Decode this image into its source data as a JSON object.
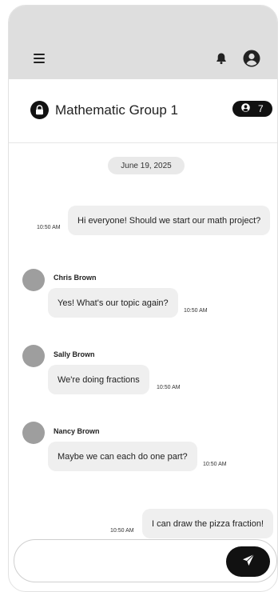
{
  "header": {
    "menu_icon": "hamburger-menu-icon",
    "notification_icon": "bell-icon",
    "profile_icon": "user-avatar-icon"
  },
  "group": {
    "icon": "lock-icon",
    "title": "Mathematic Group 1",
    "member_icon": "person-icon",
    "member_count": "7"
  },
  "chat": {
    "date_label": "June 19, 2025",
    "messages": [
      {
        "direction": "outgoing",
        "sender": "",
        "text": "Hi everyone! Should we start our math project?",
        "time": "10:50 AM"
      },
      {
        "direction": "incoming",
        "sender": "Chris Brown",
        "text": "Yes! What's our topic again?",
        "time": "10:50 AM"
      },
      {
        "direction": "incoming",
        "sender": "Sally Brown",
        "text": "We're doing fractions",
        "time": "10:50 AM"
      },
      {
        "direction": "incoming",
        "sender": "Nancy Brown",
        "text": "Maybe we can each do one part?",
        "time": "10:50 AM"
      },
      {
        "direction": "outgoing",
        "sender": "",
        "text": "I can draw the pizza fraction!",
        "time": "10:50 AM"
      }
    ]
  },
  "composer": {
    "value": "",
    "placeholder": "",
    "send_icon": "paper-plane-icon"
  },
  "colors": {
    "topbar": "#dedede",
    "bubble": "#efefef",
    "accent": "#111111",
    "avatar_placeholder": "#9e9e9e"
  }
}
